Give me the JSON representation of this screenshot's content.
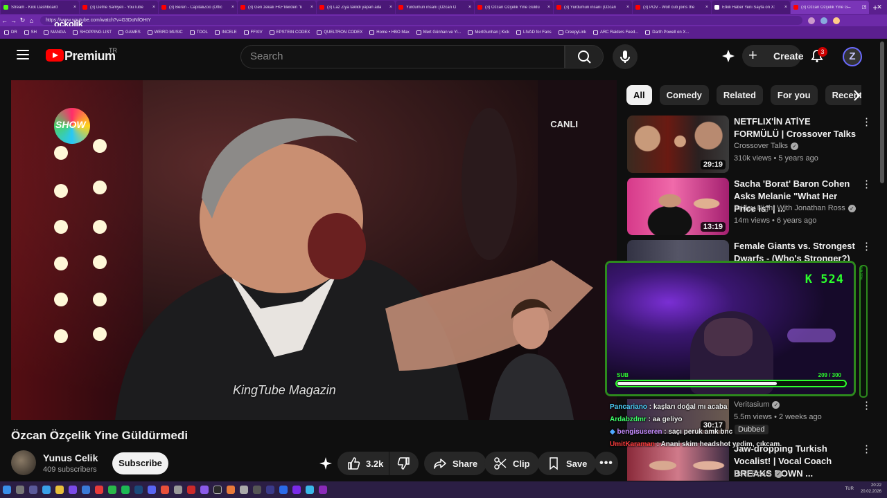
{
  "browser": {
    "tabs": [
      {
        "label": "Stream - Kick Dashboard",
        "color": "#53fc18"
      },
      {
        "label": "(3) Defne Samyeli - YouTube",
        "color": "#ff0000"
      },
      {
        "label": "(3) Beren - CapitaliZoo (Offic",
        "color": "#ff0000"
      },
      {
        "label": "(3) Geri zekalı FKF'lilerden \"k",
        "color": "#ff0000"
      },
      {
        "label": "(3) Laz Ziya taklidi yapan ada",
        "color": "#ff0000"
      },
      {
        "label": "Yurdumun insanı (Özcan Ö",
        "color": "#ff0000"
      },
      {
        "label": "(3) Özcan Özçelik Yine Güldü",
        "color": "#ff0000"
      },
      {
        "label": "(3) Yurdumun insanı (Özcan",
        "color": "#ff0000"
      },
      {
        "label": "(3) POV - Wolf cub joins the",
        "color": "#ff0000"
      },
      {
        "label": "Etkili Haber Yeni Sayfa on X:",
        "color": "#ffffff"
      },
      {
        "label": "(3) Özcan Özçelik Yine G",
        "color": "#ff0000",
        "active": true
      }
    ],
    "new_tab": "+",
    "window_controls": [
      "–",
      "□",
      "✕"
    ],
    "url": "https://www.youtube.com/watch?v=G3DoNfOHtY",
    "bookmarks": [
      "DR",
      "SH",
      "MANGA",
      "SHOPPING LIST",
      "GAMES",
      "WEIRD MUSIC",
      "TOOL",
      "INCELE",
      "FFXIV",
      "EPSTEIN CODEX",
      "QUELTRON CODEX",
      "Home • HBO Max",
      "Mert Günhan ve Yi...",
      "MertGunhan | Kick",
      "LIVAD for Fans",
      "CreepyLink",
      "ARC Raiders Feed...",
      "Darth Powell on X..."
    ],
    "overlay_brand": "ockolik"
  },
  "header": {
    "logo_text": "Premium",
    "logo_region": "TR",
    "search_placeholder": "Search",
    "create_label": "Create",
    "notification_count": "3",
    "avatar_letter": "Z"
  },
  "player": {
    "show_logo": "SHOW",
    "live_label": "CANLI",
    "caption": "KingTube Magazin"
  },
  "video": {
    "title": "Özcan Özçelik Yine Güldürmedi",
    "channel": "Yunus Celik",
    "subscribers": "409 subscribers",
    "subscribe_label": "Subscribe",
    "likes": "3.2k",
    "share_label": "Share",
    "clip_label": "Clip",
    "save_label": "Save"
  },
  "chips": [
    "All",
    "Comedy",
    "Related",
    "For you",
    "Recent"
  ],
  "recommendations": [
    {
      "title": "NETFLIX'İN ATİYE FORMÜLÜ | Crossover Talks",
      "channel": "Crossover Talks",
      "meta": "310k views • 5 years ago",
      "duration": "29:19"
    },
    {
      "title": "Sacha 'Borat' Baron Cohen Asks Melanie \"What Her Price Is\" | ...",
      "channel": "Friday Night With Jonathan Ross",
      "meta": "14m views • 6 years ago",
      "duration": "13:19"
    },
    {
      "title": "Female Giants vs. Strongest Dwarfs - (Who's Stronger?)",
      "channel": "",
      "meta": "",
      "duration": ""
    },
    {
      "title": "",
      "channel": "Veritasium",
      "meta": "5.5m views • 2 weeks ago",
      "duration": "30:17",
      "badge": "Dubbed"
    },
    {
      "title": "Jaw-dropping Turkish Vocalist! | Vocal Coach BREAKS DOWN ...",
      "channel": "Beth Roars",
      "meta": "",
      "duration": ""
    }
  ],
  "stream_overlay": {
    "kick_count": "524",
    "sub_label": "SUB",
    "sub_count": "209 / 300",
    "sub_progress": 0.697,
    "side_meter": "SUB GOAL"
  },
  "chat": [
    {
      "user": "Pancariano",
      "msg": "kaşları doğal mı acaba",
      "color": "#4fd3ff"
    },
    {
      "user": "Ardabzdmr",
      "msg": "aa geliyo",
      "color": "#3fff6a"
    },
    {
      "user": "bengisuseren",
      "msg": "saçı peruk amk bnc",
      "color": "#c58cff"
    },
    {
      "user": "UmitKaraman",
      "msg": "Anani skim headshot yedim, çıkcam",
      "color": "#ff3d3d"
    }
  ],
  "taskbar": {
    "lang": "TUR",
    "time": "20:22",
    "date": "20.02.2026"
  },
  "colors": {
    "browser_accent": "#6d2aa8",
    "yt_red": "#ff0000",
    "overlay_green": "#2cff2c"
  }
}
